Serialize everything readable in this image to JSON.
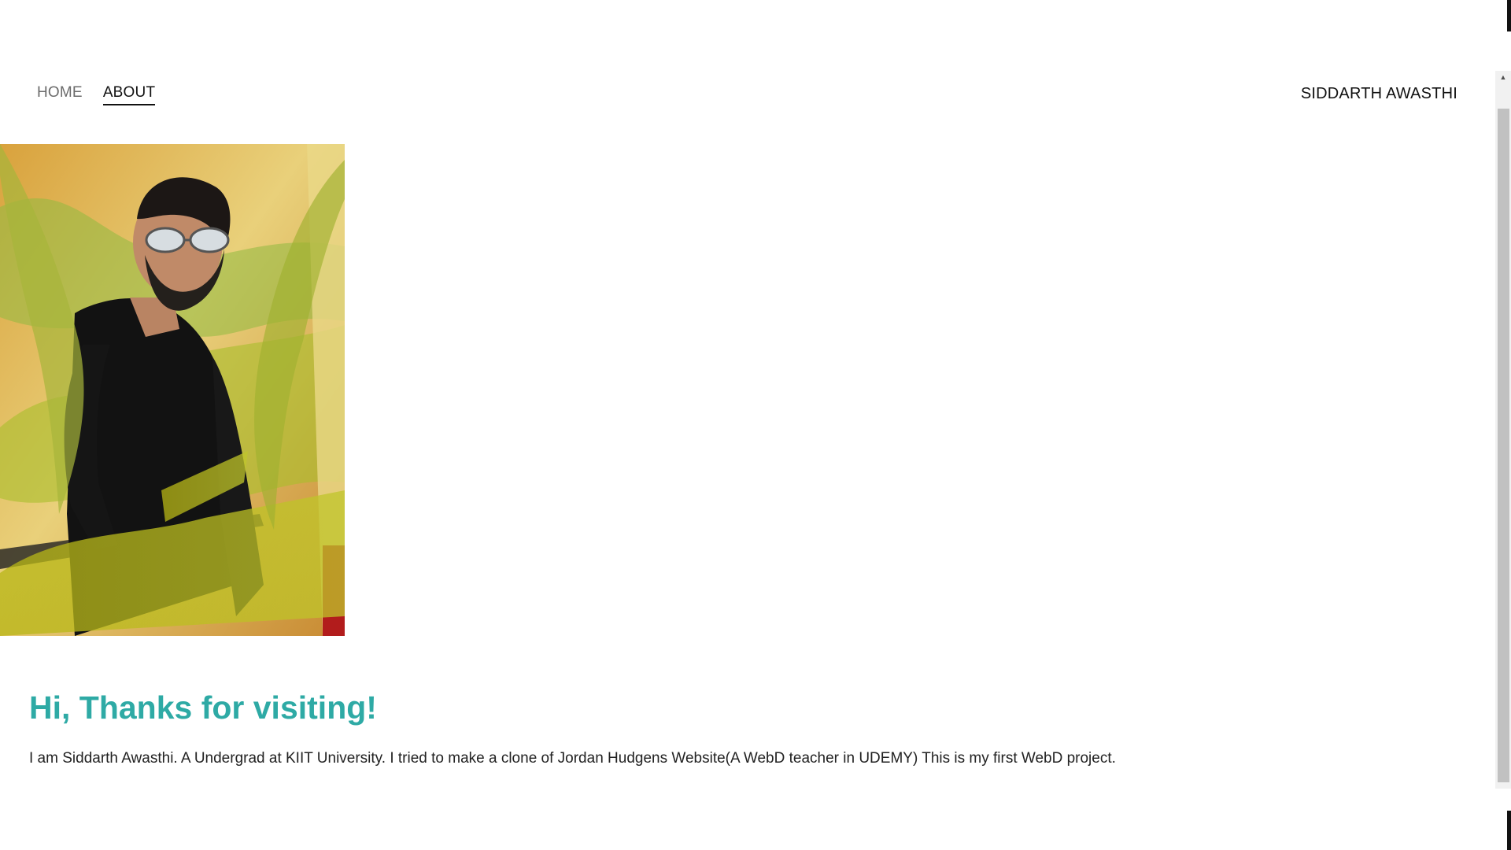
{
  "nav": {
    "items": [
      {
        "label": "HOME"
      },
      {
        "label": "ABOUT"
      }
    ]
  },
  "brand": {
    "name": "SIDDARTH AWASTHI"
  },
  "profile": {
    "icon": "person-photo"
  },
  "about": {
    "heading": "Hi, Thanks for visiting!",
    "text": "I am Siddarth Awasthi. A Undergrad at KIIT University. I tried to make a clone of Jordan Hudgens Website(A WebD teacher in UDEMY) This is my first WebD project."
  },
  "colors": {
    "accent": "#2eaaa5",
    "text": "#111111",
    "muted_nav": "#6b6b6b",
    "background": "#ffffff"
  },
  "scrollbar": {
    "up_icon": "chevron-up-icon"
  }
}
